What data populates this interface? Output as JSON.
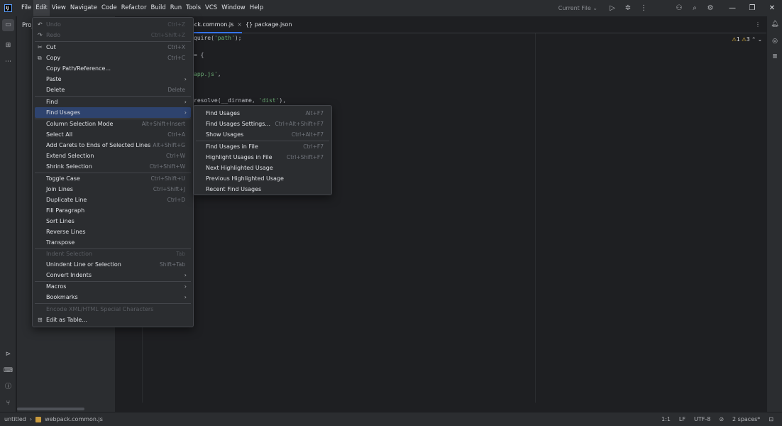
{
  "menubar": {
    "logo": "IJ",
    "items": [
      "File",
      "Edit",
      "View",
      "Navigate",
      "Code",
      "Refactor",
      "Build",
      "Run",
      "Tools",
      "VCS",
      "Window",
      "Help"
    ],
    "run_config": "Current File ⌄"
  },
  "project_panel": {
    "title": "Proj"
  },
  "tabs": [
    {
      "label": "ack.common.js",
      "close": "×"
    },
    {
      "label": "{} package.json"
    }
  ],
  "inspections": {
    "warnings_a": "1",
    "warnings_b": "3"
  },
  "code_lines": [
    {
      "pre": "quire(",
      "str": "'path'",
      "post": ");"
    },
    {
      "pre": "= {",
      "str": "",
      "post": ""
    },
    {
      "pre": "",
      "str": "app.js'",
      "post": ","
    },
    {
      "pre": "resolve(__dirname, ",
      "str": "'dist'",
      "post": "),"
    }
  ],
  "edit_menu": {
    "undo": {
      "label": "Undo",
      "shortcut": "Ctrl+Z"
    },
    "redo": {
      "label": "Redo",
      "shortcut": "Ctrl+Shift+Z"
    },
    "cut": {
      "label": "Cut",
      "shortcut": "Ctrl+X"
    },
    "copy": {
      "label": "Copy",
      "shortcut": "Ctrl+C"
    },
    "copy_path": {
      "label": "Copy Path/Reference..."
    },
    "paste": {
      "label": "Paste"
    },
    "delete": {
      "label": "Delete",
      "shortcut": "Delete"
    },
    "find": {
      "label": "Find"
    },
    "find_usages": {
      "label": "Find Usages"
    },
    "column_selection": {
      "label": "Column Selection Mode",
      "shortcut": "Alt+Shift+Insert"
    },
    "select_all": {
      "label": "Select All",
      "shortcut": "Ctrl+A"
    },
    "add_carets": {
      "label": "Add Carets to Ends of Selected Lines",
      "shortcut": "Alt+Shift+G"
    },
    "extend_selection": {
      "label": "Extend Selection",
      "shortcut": "Ctrl+W"
    },
    "shrink_selection": {
      "label": "Shrink Selection",
      "shortcut": "Ctrl+Shift+W"
    },
    "toggle_case": {
      "label": "Toggle Case",
      "shortcut": "Ctrl+Shift+U"
    },
    "join_lines": {
      "label": "Join Lines",
      "shortcut": "Ctrl+Shift+J"
    },
    "duplicate_line": {
      "label": "Duplicate Line",
      "shortcut": "Ctrl+D"
    },
    "fill_paragraph": {
      "label": "Fill Paragraph"
    },
    "sort_lines": {
      "label": "Sort Lines"
    },
    "reverse_lines": {
      "label": "Reverse Lines"
    },
    "transpose": {
      "label": "Transpose"
    },
    "indent_selection": {
      "label": "Indent Selection",
      "shortcut": "Tab"
    },
    "unindent": {
      "label": "Unindent Line or Selection",
      "shortcut": "Shift+Tab"
    },
    "convert_indents": {
      "label": "Convert Indents"
    },
    "macros": {
      "label": "Macros"
    },
    "bookmarks": {
      "label": "Bookmarks"
    },
    "encode_xml": {
      "label": "Encode XML/HTML Special Characters"
    },
    "edit_as_table": {
      "label": "Edit as Table..."
    }
  },
  "find_usages_menu": {
    "find_usages": {
      "label": "Find Usages",
      "shortcut": "Alt+F7"
    },
    "settings": {
      "label": "Find Usages Settings...",
      "shortcut": "Ctrl+Alt+Shift+F7"
    },
    "show_usages": {
      "label": "Show Usages",
      "shortcut": "Ctrl+Alt+F7"
    },
    "find_in_file": {
      "label": "Find Usages in File",
      "shortcut": "Ctrl+F7"
    },
    "highlight_in_file": {
      "label": "Highlight Usages in File",
      "shortcut": "Ctrl+Shift+F7"
    },
    "next_highlighted": {
      "label": "Next Highlighted Usage"
    },
    "previous_highlighted": {
      "label": "Previous Highlighted Usage"
    },
    "recent": {
      "label": "Recent Find Usages"
    }
  },
  "statusbar": {
    "project": "untitled",
    "file": "webpack.common.js",
    "position": "1:1",
    "line_sep": "LF",
    "encoding": "UTF-8",
    "indent": "2 spaces*"
  },
  "colors": {
    "accent": "#3574f0",
    "highlight": "#2e436e",
    "string": "#6aab73",
    "warning": "#e0b43b"
  }
}
